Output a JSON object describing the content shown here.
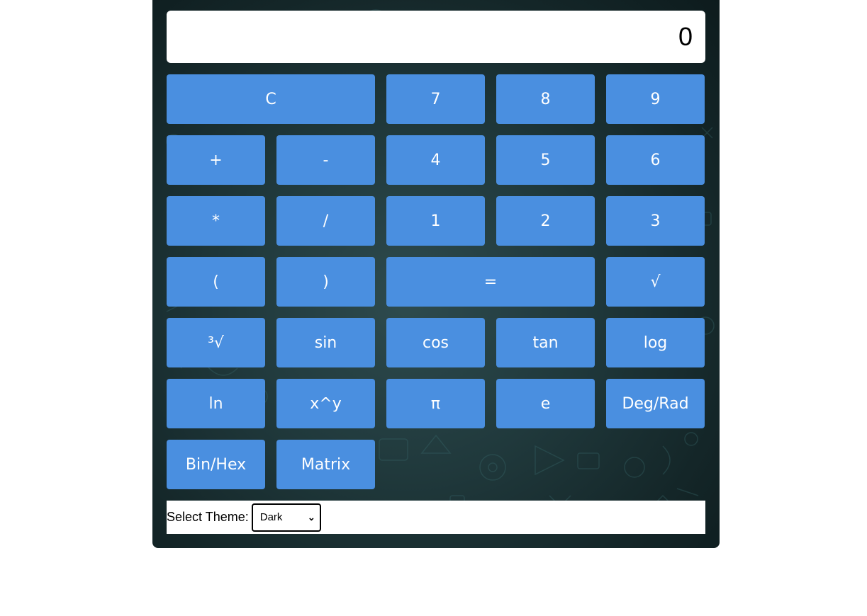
{
  "display": {
    "value": "0"
  },
  "keys": [
    "C",
    "7",
    "8",
    "9",
    "+",
    "-",
    "4",
    "5",
    "6",
    "*",
    "/",
    "1",
    "2",
    "3",
    "(",
    ")",
    "=",
    "√",
    "³√",
    "sin",
    "cos",
    "tan",
    "log",
    "ln",
    "x^y",
    "π",
    "e",
    "Deg/Rad",
    "Bin/Hex",
    "Matrix"
  ],
  "theme": {
    "label": "Select Theme:",
    "selected": "Dark"
  },
  "colors": {
    "key_background": "#4a8fe0",
    "key_text": "#ffffff",
    "display_background": "#ffffff",
    "panel_background": "#20393c"
  },
  "icons": {
    "select": "chevron-down-icon"
  }
}
